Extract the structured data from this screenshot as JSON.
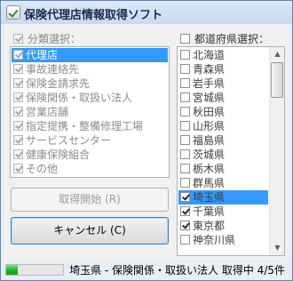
{
  "window": {
    "title": "保険代理店情報取得ソフト"
  },
  "left_panel": {
    "group_label": "分類選択：",
    "items": [
      {
        "label": "代理店",
        "checked": true,
        "selected": true
      },
      {
        "label": "事故連絡先",
        "checked": true
      },
      {
        "label": "保険金請求先",
        "checked": true
      },
      {
        "label": "保険関係・取扱い法人",
        "checked": true
      },
      {
        "label": "営業店舗",
        "checked": true
      },
      {
        "label": "指定提携・整備修理工場",
        "checked": true
      },
      {
        "label": "サービスセンター",
        "checked": true
      },
      {
        "label": "健康保険組合",
        "checked": true
      },
      {
        "label": "その他",
        "checked": true
      }
    ]
  },
  "right_panel": {
    "group_label": "都道府県選択：",
    "items": [
      {
        "label": "北海道",
        "checked": false
      },
      {
        "label": "青森県",
        "checked": false
      },
      {
        "label": "岩手県",
        "checked": false
      },
      {
        "label": "宮城県",
        "checked": false
      },
      {
        "label": "秋田県",
        "checked": false
      },
      {
        "label": "山形県",
        "checked": false
      },
      {
        "label": "福島県",
        "checked": false
      },
      {
        "label": "茨城県",
        "checked": false
      },
      {
        "label": "栃木県",
        "checked": false
      },
      {
        "label": "群馬県",
        "checked": false
      },
      {
        "label": "埼玉県",
        "checked": true,
        "selected": true
      },
      {
        "label": "千葉県",
        "checked": true
      },
      {
        "label": "東京都",
        "checked": true
      },
      {
        "label": "神奈川県",
        "checked": false
      }
    ]
  },
  "buttons": {
    "start": "取得開始 (R)",
    "cancel": "キャンセル (C)"
  },
  "status": {
    "text": "埼玉県 - 保険関係・取扱い法人 取得中 4/5件",
    "progress": 0.2,
    "progress_color": "#22b222"
  }
}
